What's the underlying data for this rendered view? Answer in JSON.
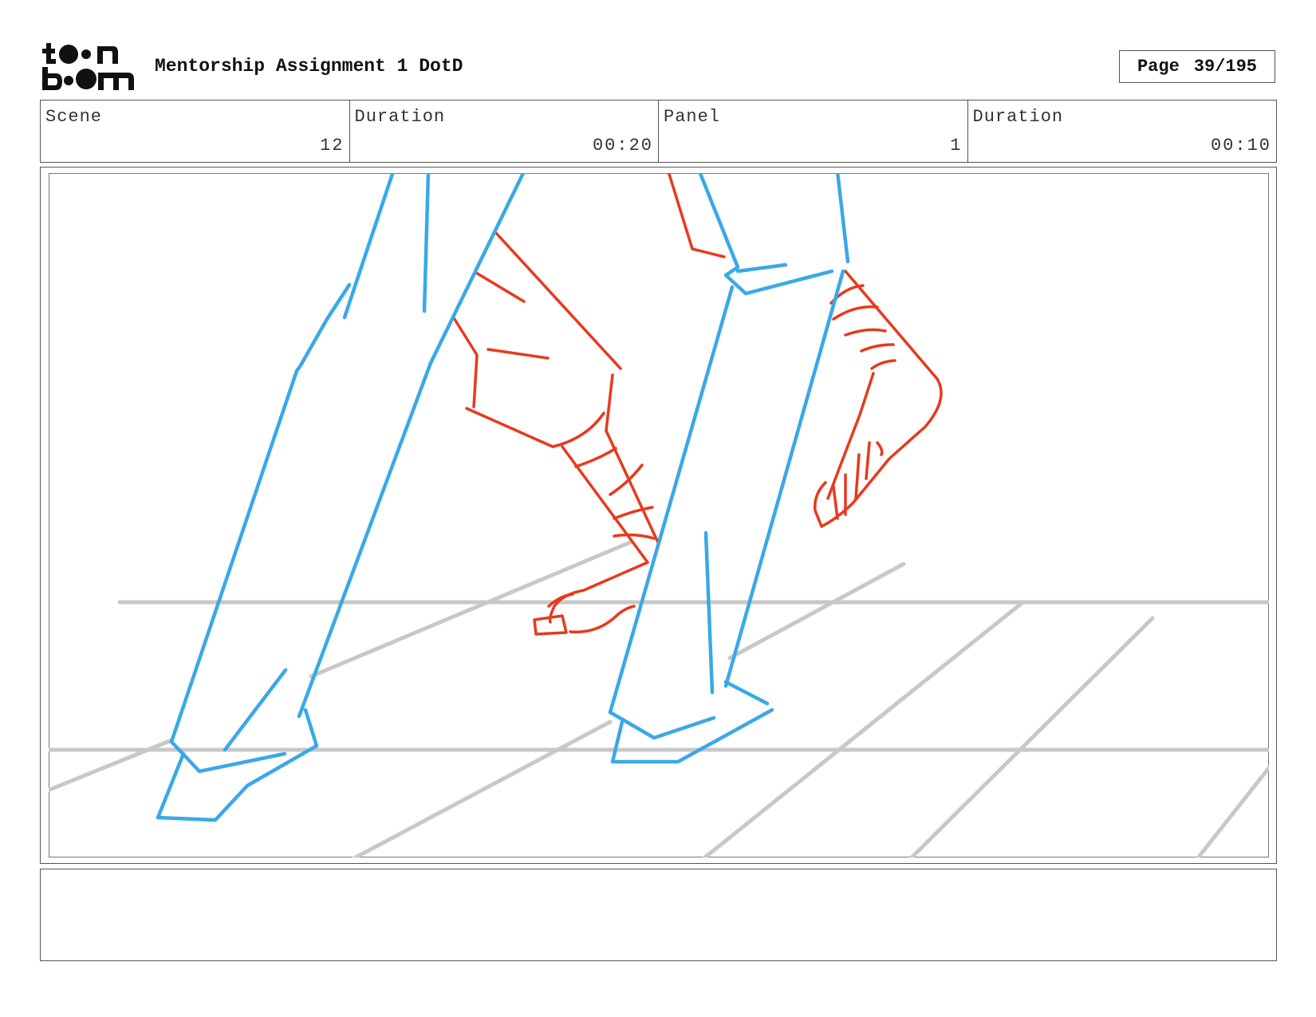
{
  "header": {
    "logo_text": "toon boom",
    "project_title": "Mentorship Assignment 1 DotD",
    "page_label": "Page",
    "page_number": "39/195"
  },
  "info": {
    "scene_label": "Scene",
    "scene_value": "12",
    "scene_duration_label": "Duration",
    "scene_duration_value": "00:20",
    "panel_label": "Panel",
    "panel_value": "1",
    "panel_duration_label": "Duration",
    "panel_duration_value": "00:10"
  },
  "panel": {
    "sketch_colors": {
      "foreground_legs": "#3aa8e8",
      "background_legs": "#e8391c",
      "floor": "#c8c8c8"
    }
  },
  "notes": {
    "text": ""
  }
}
